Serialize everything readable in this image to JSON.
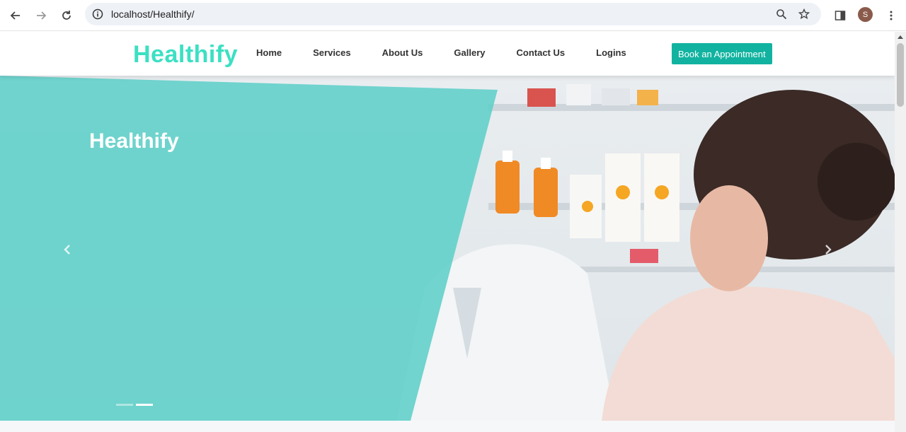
{
  "browser": {
    "url": "localhost/Healthify/",
    "profile_initial": "S",
    "icons": [
      "back-arrow-icon",
      "forward-arrow-icon",
      "reload-icon",
      "site-info-icon",
      "zoom-icon",
      "bookmark-star-icon",
      "side-panel-icon",
      "more-vert-icon"
    ]
  },
  "header": {
    "logo": "Healthify",
    "nav": [
      {
        "label": "Home"
      },
      {
        "label": "Services"
      },
      {
        "label": "About Us"
      },
      {
        "label": "Gallery"
      },
      {
        "label": "Contact Us"
      },
      {
        "label": "Logins"
      }
    ],
    "cta_label": "Book an Appointment"
  },
  "hero": {
    "title": "Healthify",
    "slides_count": 2,
    "active_slide": 2,
    "overlay_color": "#5fcfc8"
  },
  "colors": {
    "accent": "#11b3a0",
    "logo": "#3be0c3"
  }
}
